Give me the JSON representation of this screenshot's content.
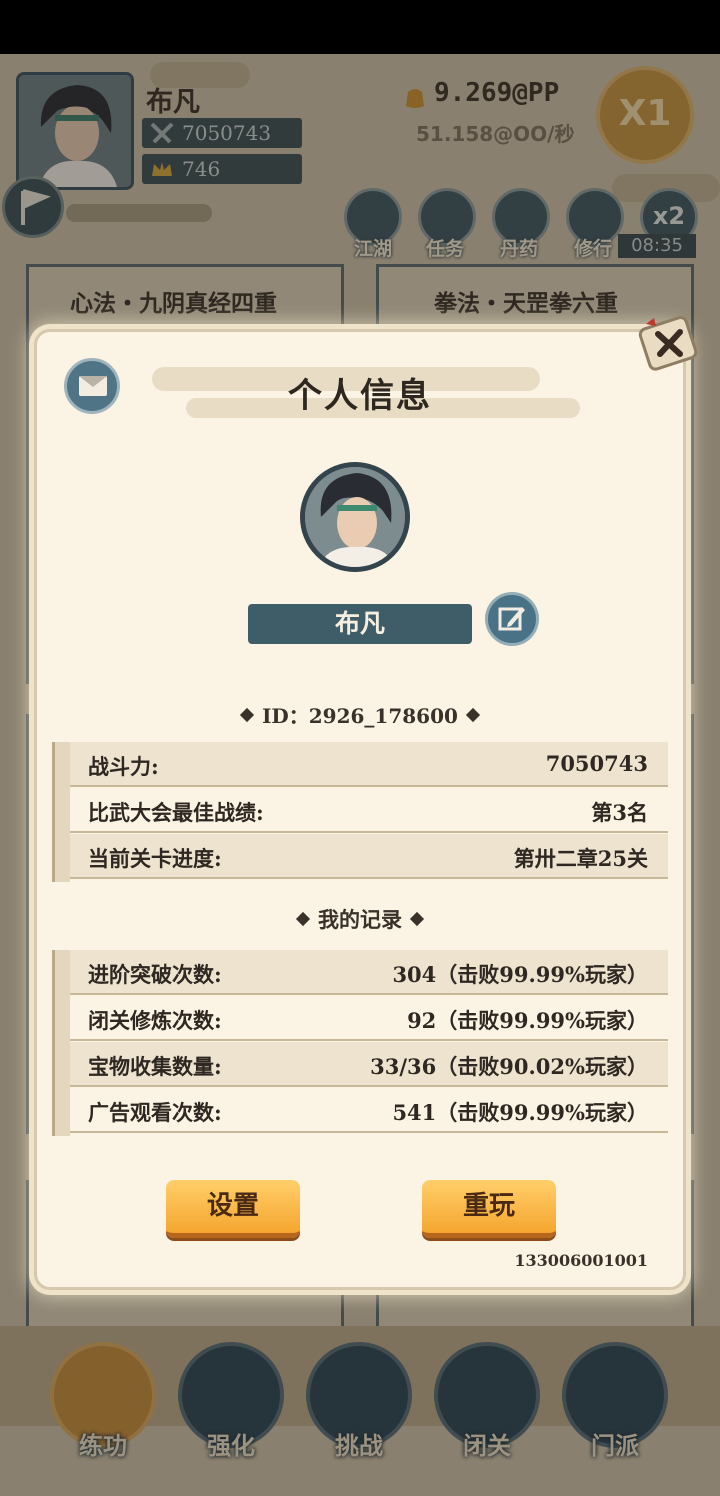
{
  "background": {
    "player_name": "布凡",
    "power": "7050743",
    "ingots": "746",
    "gold": "9.269@PP",
    "gold_rate": "51.158@OO/秒",
    "speed": "X1",
    "nav": [
      "江湖",
      "任务",
      "丹药",
      "修行"
    ],
    "boost": "x2",
    "timer": "08:35",
    "cards": [
      "心法・九阴真经四重",
      "拳法・天罡拳六重"
    ],
    "bottom_nav": [
      "练功",
      "强化",
      "挑战",
      "闭关",
      "门派"
    ],
    "colors": {
      "accent": "#c48b3c",
      "teal": "#2d4655"
    }
  },
  "modal": {
    "title": "个人信息",
    "player_name": "布凡",
    "id_line": "ID：2926_178600",
    "stats": [
      {
        "label": "战斗力:",
        "value": "7050743"
      },
      {
        "label": "比武大会最佳战绩:",
        "value": "第3名"
      },
      {
        "label": "当前关卡进度:",
        "value": "第卅二章25关"
      }
    ],
    "records_title": "我的记录",
    "records": [
      {
        "label": "进阶突破次数:",
        "value": "304（击败99.99%玩家）"
      },
      {
        "label": "闭关修炼次数:",
        "value": "92（击败99.99%玩家）"
      },
      {
        "label": "宝物收集数量:",
        "value": "33/36（击败90.02%玩家）"
      },
      {
        "label": "广告观看次数:",
        "value": "541（击败99.99%玩家）"
      }
    ],
    "settings_label": "设置",
    "replay_label": "重玩",
    "code": "133006001001",
    "icons": {
      "mail": "mail-icon",
      "close": "close-icon",
      "edit": "edit-icon"
    },
    "colors": {
      "button": "#f5a52f",
      "name_box": "#3f5d69",
      "panel": "#fbf3e3"
    }
  }
}
